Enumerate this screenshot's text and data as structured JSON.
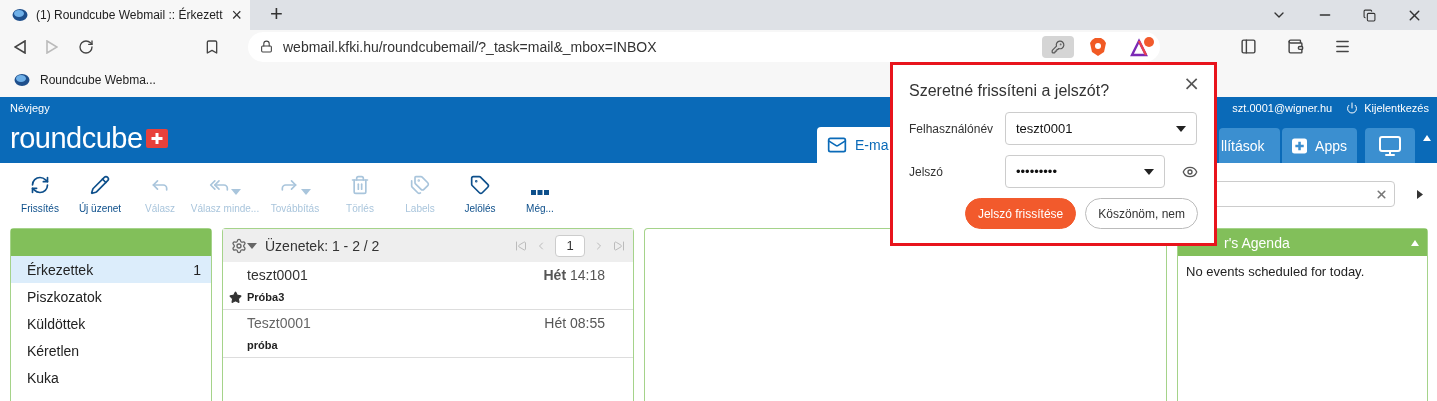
{
  "browser": {
    "tab": {
      "title": "(1) Roundcube Webmail :: Érkezett",
      "close": "×",
      "selected": true
    },
    "new_tab": "+",
    "address": "webmail.kfki.hu/roundcubemail/?_task=mail&_mbox=INBOX",
    "bookmark": "Roundcube Webma..."
  },
  "header": {
    "about": "Névjegy",
    "user": "szt.0001@wigner.hu",
    "logout": "Kijelentkezés",
    "logo": "roundcube",
    "tabs": [
      {
        "kind": "mail",
        "label": "E-ma",
        "selected": true
      },
      {
        "kind": "settings",
        "label": "llítások",
        "selected": false
      },
      {
        "kind": "apps",
        "label": "Apps",
        "selected": false
      },
      {
        "kind": "screen",
        "selected": false
      }
    ]
  },
  "toolbar": [
    {
      "label": "Frissítés",
      "disabled": false,
      "menu": false
    },
    {
      "label": "Új üzenet",
      "disabled": false,
      "menu": false
    },
    {
      "label": "Válasz",
      "disabled": true,
      "menu": false
    },
    {
      "label": "Válasz minde...",
      "disabled": true,
      "menu": true
    },
    {
      "label": "Továbbítás",
      "disabled": true,
      "menu": true
    },
    {
      "label": "Törlés",
      "disabled": true,
      "menu": false
    },
    {
      "label": "Labels",
      "disabled": true,
      "menu": false
    },
    {
      "label": "Jelölés",
      "disabled": false,
      "menu": false
    },
    {
      "label": "Még...",
      "disabled": false,
      "menu": false
    }
  ],
  "folders": [
    {
      "name": "Érkezettek",
      "count": "1",
      "selected": true
    },
    {
      "name": "Piszkozatok",
      "selected": false
    },
    {
      "name": "Küldöttek",
      "selected": false
    },
    {
      "name": "Kéretlen",
      "selected": false
    },
    {
      "name": "Kuka",
      "selected": false
    }
  ],
  "messages": {
    "title": "Üzenetek: 1 - 2 / 2",
    "page": "1",
    "rows": [
      {
        "from": "teszt0001",
        "day": "Hét",
        "time": "14:18",
        "subject": "Próba3",
        "unread": true,
        "flagged": true
      },
      {
        "from": "Teszt0001",
        "day": "Hét",
        "time": "08:55",
        "subject": "próba",
        "unread": false,
        "flagged": false
      }
    ]
  },
  "agenda": {
    "title": "r's Agenda",
    "empty": "No events scheduled for today."
  },
  "dialog": {
    "title": "Szeretné frissíteni a jelszót?",
    "close": "×",
    "fields": [
      {
        "kind": "text",
        "label": "Felhasználónév",
        "value": "teszt0001"
      },
      {
        "kind": "password",
        "label": "Jelszó",
        "value": "•••••••••"
      }
    ],
    "buttons": [
      {
        "label": "Jelszó frissítése",
        "primary": true
      },
      {
        "label": "Köszönöm, nem",
        "primary": false
      }
    ]
  }
}
